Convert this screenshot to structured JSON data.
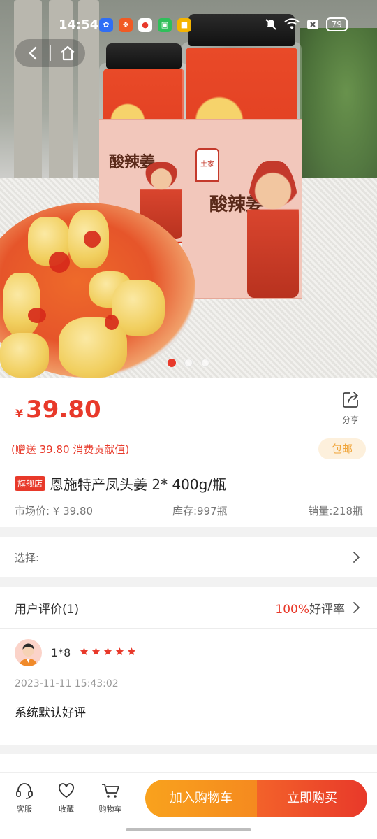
{
  "status_bar": {
    "time": "14:54",
    "battery": "79",
    "app_icons": [
      "paw-app-icon",
      "gift-app-icon",
      "map-pin-app-icon",
      "shopping-app-icon",
      "notes-app-icon"
    ]
  },
  "gallery": {
    "image_count": 3,
    "active_index": 0,
    "jar_label_text": "酸辣姜",
    "jar_badge_text": "土家"
  },
  "product": {
    "currency_symbol": "¥",
    "price": "39.80",
    "share_label": "分享",
    "gift_text": "(赠送 39.80 消费贡献值)",
    "free_shipping": "包邮",
    "shop_badge": "旗舰店",
    "title": "恩施特产凤头姜 2* 400g/瓶",
    "market_price": "市场价: ¥ 39.80",
    "stock": "库存:997瓶",
    "sales": "销量:218瓶"
  },
  "selection": {
    "label": "选择:"
  },
  "reviews": {
    "header": "用户评价(1)",
    "good_rate_pct": "100%",
    "good_rate_label": "好评率",
    "items": [
      {
        "user": "1*8",
        "stars": 5,
        "date": "2023-11-11 15:43:02",
        "text": "系统默认好评"
      }
    ]
  },
  "bottom_bar": {
    "service": "客服",
    "favorite": "收藏",
    "cart": "购物车",
    "add_to_cart": "加入购物车",
    "buy_now": "立即购买"
  },
  "colors": {
    "accent": "#e8392a",
    "orange": "#f9a21d",
    "freeship_bg": "#fdf0dc",
    "freeship_text": "#f0a53a"
  }
}
